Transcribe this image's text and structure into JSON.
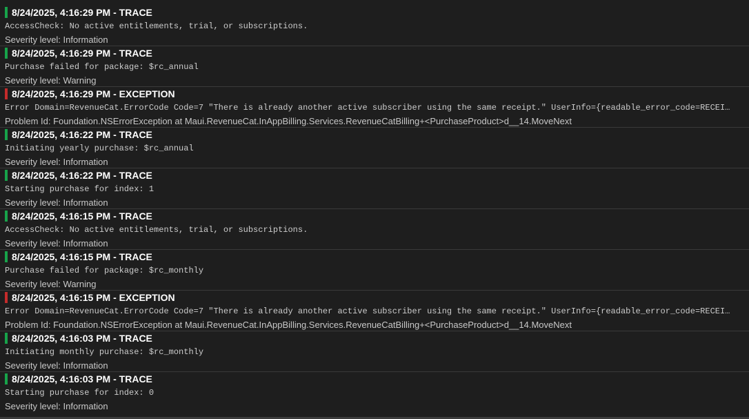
{
  "colors": {
    "trace": "#17a34a",
    "exception": "#c42b2b"
  },
  "entries": [
    {
      "timestamp": "8/24/2025, 4:16:29 PM",
      "separator": " - ",
      "level": "TRACE",
      "kind": "trace",
      "message": "AccessCheck: No active entitlements, trial, or subscriptions.",
      "detail": "Severity level: Information"
    },
    {
      "timestamp": "8/24/2025, 4:16:29 PM",
      "separator": " - ",
      "level": "TRACE",
      "kind": "trace",
      "message": "Purchase failed for package: $rc_annual",
      "detail": "Severity level: Warning"
    },
    {
      "timestamp": "8/24/2025, 4:16:29 PM",
      "separator": " - ",
      "level": "EXCEPTION",
      "kind": "exception",
      "message": "Error Domain=RevenueCat.ErrorCode Code=7 \"There is already another active subscriber using the same receipt.\" UserInfo={readable_error_code=RECEIPT_ALREADY_IN_USE",
      "detail": "Problem Id: Foundation.NSErrorException at Maui.RevenueCat.InAppBilling.Services.RevenueCatBilling+<PurchaseProduct>d__14.MoveNext"
    },
    {
      "timestamp": "8/24/2025, 4:16:22 PM",
      "separator": " - ",
      "level": "TRACE",
      "kind": "trace",
      "message": "Initiating yearly purchase: $rc_annual",
      "detail": "Severity level: Information"
    },
    {
      "timestamp": "8/24/2025, 4:16:22 PM",
      "separator": " - ",
      "level": "TRACE",
      "kind": "trace",
      "message": "Starting purchase for index: 1",
      "detail": "Severity level: Information"
    },
    {
      "timestamp": "8/24/2025, 4:16:15 PM",
      "separator": " - ",
      "level": "TRACE",
      "kind": "trace",
      "message": "AccessCheck: No active entitlements, trial, or subscriptions.",
      "detail": "Severity level: Information"
    },
    {
      "timestamp": "8/24/2025, 4:16:15 PM",
      "separator": " - ",
      "level": "TRACE",
      "kind": "trace",
      "message": "Purchase failed for package: $rc_monthly",
      "detail": "Severity level: Warning"
    },
    {
      "timestamp": "8/24/2025, 4:16:15 PM",
      "separator": " - ",
      "level": "EXCEPTION",
      "kind": "exception",
      "message": "Error Domain=RevenueCat.ErrorCode Code=7 \"There is already another active subscriber using the same receipt.\" UserInfo={readable_error_code=RECEIPT_ALREADY_IN_USE",
      "detail": "Problem Id: Foundation.NSErrorException at Maui.RevenueCat.InAppBilling.Services.RevenueCatBilling+<PurchaseProduct>d__14.MoveNext"
    },
    {
      "timestamp": "8/24/2025, 4:16:03 PM",
      "separator": " - ",
      "level": "TRACE",
      "kind": "trace",
      "message": "Initiating monthly purchase: $rc_monthly",
      "detail": "Severity level: Information"
    },
    {
      "timestamp": "8/24/2025, 4:16:03 PM",
      "separator": " - ",
      "level": "TRACE",
      "kind": "trace",
      "message": "Starting purchase for index: 0",
      "detail": "Severity level: Information"
    }
  ]
}
